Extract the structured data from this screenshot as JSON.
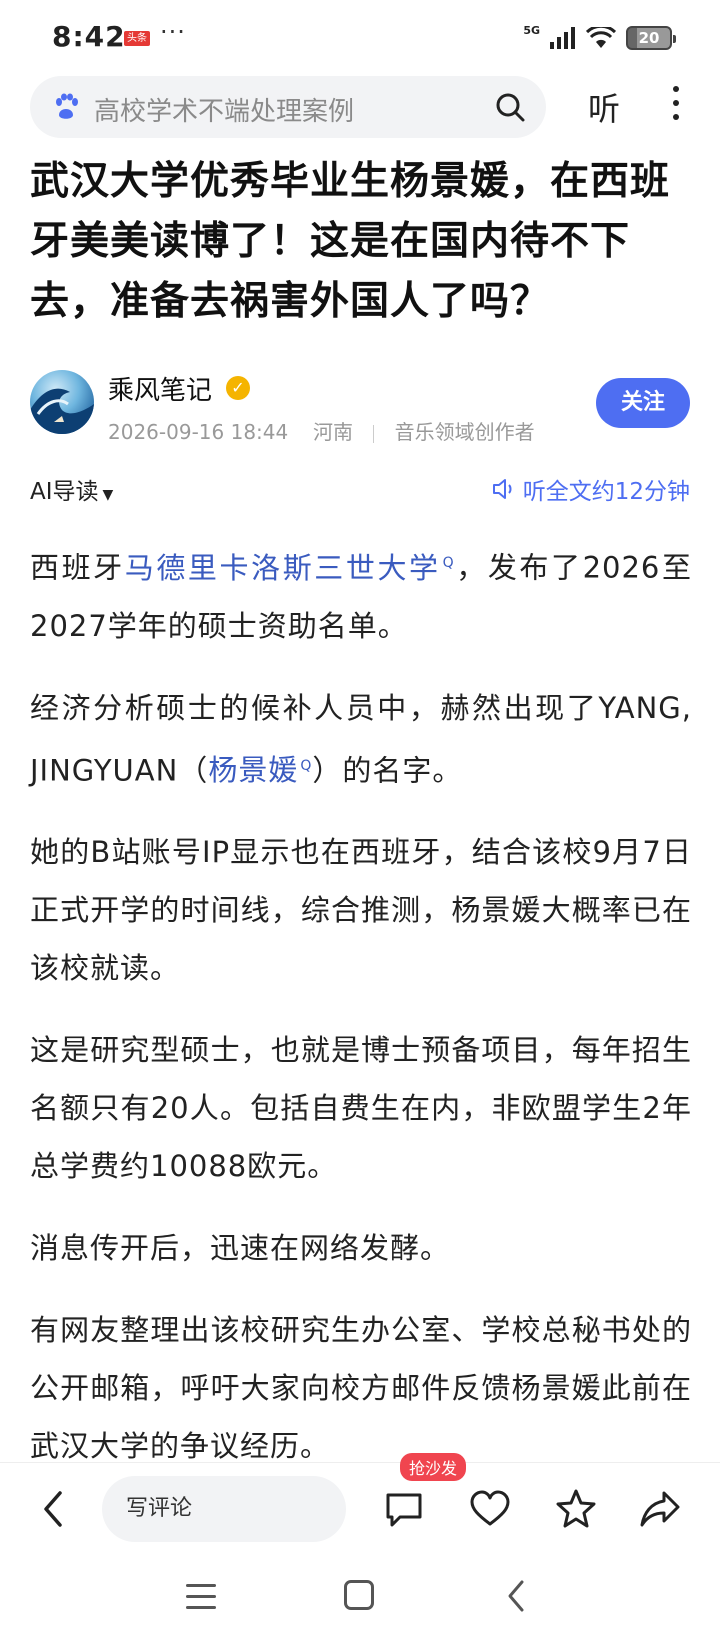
{
  "status": {
    "time": "8:42",
    "app_badge": "头条",
    "more_dots": "···",
    "network": "5G",
    "battery": "20"
  },
  "search": {
    "placeholder": "高校学术不端处理案例",
    "listen_label": "听"
  },
  "article": {
    "title": "武汉大学优秀毕业生杨景媛，在西班牙美美读博了！这是在国内待不下去，准备去祸害外国人了吗？",
    "author": {
      "name": "乘风笔记",
      "datetime": "2026-09-16 18:44",
      "location": "河南",
      "role": "音乐领域创作者",
      "follow_label": "关注"
    },
    "ai_guide_label": "AI导读",
    "listen_full_label": "听全文约12分钟",
    "paragraphs": {
      "p1_pre": "西班牙",
      "p1_link": "马德里卡洛斯三世大学",
      "p1_post": "，发布了2026至2027学年的硕士资助名单。",
      "p2_pre": "经济分析硕士的候补人员中，赫然出现了YANG, JINGYUAN（",
      "p2_link": "杨景媛",
      "p2_post": "）的名字。",
      "p3": "她的B站账号IP显示也在西班牙，结合该校9月7日正式开学的时间线，综合推测，杨景媛大概率已在该校就读。",
      "p4": "这是研究型硕士，也就是博士预备项目，每年招生名额只有20人。包括自费生在内，非欧盟学生2年总学费约10088欧元。",
      "p5": "消息传开后，迅速在网络发酵。",
      "p6": "有网友整理出该校研究生办公室、学校总秘书处的公开邮箱，呼吁大家向校方邮件反馈杨景媛此前在武汉大学的争议经历。"
    },
    "link_marker": "Q"
  },
  "action_bar": {
    "comment_placeholder": "写评论",
    "sofa_badge": "抢沙发"
  },
  "colors": {
    "accent": "#4e6ef2",
    "link": "#3a5bbf",
    "badge_red": "#f0454f"
  },
  "icons": [
    "baidu-paw-icon",
    "search-icon",
    "more-icon",
    "verified-icon",
    "speaker-icon",
    "back-arrow-icon",
    "comment-icon",
    "heart-icon",
    "star-icon",
    "share-icon"
  ]
}
